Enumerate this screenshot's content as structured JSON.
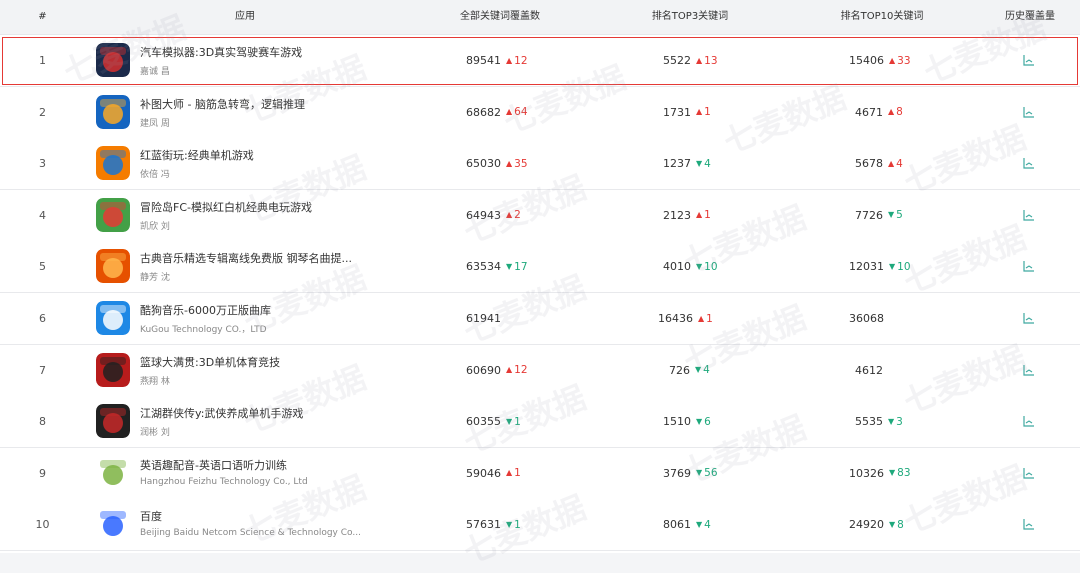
{
  "headers": {
    "rank": "#",
    "app": "应用",
    "all_keywords": "全部关键词覆盖数",
    "top3": "排名TOP3关键词",
    "top10": "排名TOP10关键词",
    "history": "历史覆盖量"
  },
  "watermark": "七麦数据",
  "colors": {
    "up": "#e53935",
    "down": "#1ea97c",
    "highlight_border": "#e53935"
  },
  "rows": [
    {
      "rank": "1",
      "name": "汽车模拟器:3D真实驾驶赛车游戏",
      "dev": "嘉诚 昌",
      "icon": "car-racing-icon",
      "iconColors": [
        "#1b2a4a",
        "#d32f2f"
      ],
      "all": "89541",
      "all_chg": "12",
      "all_dir": "up",
      "top3": "5522",
      "top3_chg": "13",
      "top3_dir": "up",
      "top10": "15406",
      "top10_chg": "33",
      "top10_dir": "up"
    },
    {
      "rank": "2",
      "name": "补图大师 - 脑筋急转弯，逻辑推理",
      "dev": "建凤 周",
      "icon": "stickman-icon",
      "iconColors": [
        "#1565c0",
        "#f9a825"
      ],
      "all": "68682",
      "all_chg": "64",
      "all_dir": "up",
      "top3": "1731",
      "top3_chg": "1",
      "top3_dir": "up",
      "top10": "4671",
      "top10_chg": "8",
      "top10_dir": "up"
    },
    {
      "rank": "3",
      "name": "红蓝街玩:经典单机游戏",
      "dev": "依倍 冯",
      "icon": "arcade-icon",
      "iconColors": [
        "#f57c00",
        "#1976d2"
      ],
      "all": "65030",
      "all_chg": "35",
      "all_dir": "up",
      "top3": "1237",
      "top3_chg": "4",
      "top3_dir": "down",
      "top10": "5678",
      "top10_chg": "4",
      "top10_dir": "up"
    },
    {
      "rank": "4",
      "name": "冒险岛FC-模拟红白机经典电玩游戏",
      "dev": "凯欣 刘",
      "icon": "adventure-island-icon",
      "iconColors": [
        "#43a047",
        "#e53935"
      ],
      "all": "64943",
      "all_chg": "2",
      "all_dir": "up",
      "top3": "2123",
      "top3_chg": "1",
      "top3_dir": "up",
      "top10": "7726",
      "top10_chg": "5",
      "top10_dir": "down"
    },
    {
      "rank": "5",
      "name": "古典音乐精选专辑离线免费版 钢琴名曲提...",
      "dev": "静芳 沈",
      "icon": "classical-music-icon",
      "iconColors": [
        "#e65100",
        "#ffb74d"
      ],
      "all": "63534",
      "all_chg": "17",
      "all_dir": "down",
      "top3": "4010",
      "top3_chg": "10",
      "top3_dir": "down",
      "top10": "12031",
      "top10_chg": "10",
      "top10_dir": "down"
    },
    {
      "rank": "6",
      "name": "酷狗音乐-6000万正版曲库",
      "dev": "KuGou Technology CO.，LTD",
      "icon": "kugou-icon",
      "iconColors": [
        "#1e88e5",
        "#ffffff"
      ],
      "all": "61941",
      "all_chg": "",
      "all_dir": "",
      "top3": "16436",
      "top3_chg": "1",
      "top3_dir": "up",
      "top10": "36068",
      "top10_chg": "",
      "top10_dir": ""
    },
    {
      "rank": "7",
      "name": "篮球大满贯:3D单机体育竞技",
      "dev": "燕翔 林",
      "icon": "basketball-icon",
      "iconColors": [
        "#b71c1c",
        "#212121"
      ],
      "all": "60690",
      "all_chg": "12",
      "all_dir": "up",
      "top3": "726",
      "top3_chg": "4",
      "top3_dir": "down",
      "top10": "4612",
      "top10_chg": "",
      "top10_dir": ""
    },
    {
      "rank": "8",
      "name": "江湖群侠传y:武侠养成单机手游戏",
      "dev": "润彬 刘",
      "icon": "wuxia-icon",
      "iconColors": [
        "#212121",
        "#c62828"
      ],
      "all": "60355",
      "all_chg": "1",
      "all_dir": "down",
      "top3": "1510",
      "top3_chg": "6",
      "top3_dir": "down",
      "top10": "5535",
      "top10_chg": "3",
      "top10_dir": "down"
    },
    {
      "rank": "9",
      "name": "英语趣配音-英语口语听力训练",
      "dev": "Hangzhou Feizhu Technology Co., Ltd",
      "icon": "bird-icon",
      "iconColors": [
        "#ffffff",
        "#7cb342"
      ],
      "all": "59046",
      "all_chg": "1",
      "all_dir": "up",
      "top3": "3769",
      "top3_chg": "56",
      "top3_dir": "down",
      "top10": "10326",
      "top10_chg": "83",
      "top10_dir": "down"
    },
    {
      "rank": "10",
      "name": "百度",
      "dev": "Beijing Baidu Netcom Science & Technology Co...",
      "icon": "baidu-icon",
      "iconColors": [
        "#ffffff",
        "#2962ff"
      ],
      "all": "57631",
      "all_chg": "1",
      "all_dir": "down",
      "top3": "8061",
      "top3_chg": "4",
      "top3_dir": "down",
      "top10": "24920",
      "top10_chg": "8",
      "top10_dir": "down"
    }
  ]
}
